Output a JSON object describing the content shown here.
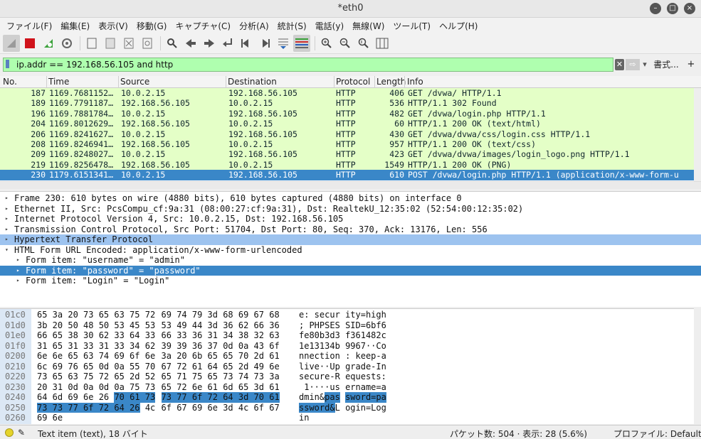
{
  "window": {
    "title": "*eth0"
  },
  "menu": [
    "ファイル(F)",
    "編集(E)",
    "表示(V)",
    "移動(G)",
    "キャプチャ(C)",
    "分析(A)",
    "統計(S)",
    "電話(y)",
    "無線(W)",
    "ツール(T)",
    "ヘルプ(H)"
  ],
  "filter": {
    "value": "ip.addr == 192.168.56.105 and http",
    "expr_label": "書式...",
    "plus": "+"
  },
  "columns": [
    "No.",
    "Time",
    "Source",
    "Destination",
    "Protocol",
    "Length",
    "Info"
  ],
  "packets": [
    {
      "no": "187",
      "time": "1169.7681152…",
      "src": "10.0.2.15",
      "dst": "192.168.56.105",
      "proto": "HTTP",
      "len": "406",
      "info": "GET /dvwa/ HTTP/1.1"
    },
    {
      "no": "189",
      "time": "1169.7791187…",
      "src": "192.168.56.105",
      "dst": "10.0.2.15",
      "proto": "HTTP",
      "len": "536",
      "info": "HTTP/1.1 302 Found"
    },
    {
      "no": "196",
      "time": "1169.7881784…",
      "src": "10.0.2.15",
      "dst": "192.168.56.105",
      "proto": "HTTP",
      "len": "482",
      "info": "GET /dvwa/login.php HTTP/1.1"
    },
    {
      "no": "204",
      "time": "1169.8012629…",
      "src": "192.168.56.105",
      "dst": "10.0.2.15",
      "proto": "HTTP",
      "len": "60",
      "info": "HTTP/1.1 200 OK  (text/html)"
    },
    {
      "no": "206",
      "time": "1169.8241627…",
      "src": "10.0.2.15",
      "dst": "192.168.56.105",
      "proto": "HTTP",
      "len": "430",
      "info": "GET /dvwa/dvwa/css/login.css HTTP/1.1"
    },
    {
      "no": "208",
      "time": "1169.8246941…",
      "src": "192.168.56.105",
      "dst": "10.0.2.15",
      "proto": "HTTP",
      "len": "957",
      "info": "HTTP/1.1 200 OK  (text/css)"
    },
    {
      "no": "209",
      "time": "1169.8248027…",
      "src": "10.0.2.15",
      "dst": "192.168.56.105",
      "proto": "HTTP",
      "len": "423",
      "info": "GET /dvwa/dvwa/images/login_logo.png HTTP/1.1"
    },
    {
      "no": "219",
      "time": "1169.8256478…",
      "src": "192.168.56.105",
      "dst": "10.0.2.15",
      "proto": "HTTP",
      "len": "1549",
      "info": "HTTP/1.1 200 OK  (PNG)"
    },
    {
      "no": "230",
      "time": "1179.6151341…",
      "src": "10.0.2.15",
      "dst": "192.168.56.105",
      "proto": "HTTP",
      "len": "610",
      "info": "POST /dvwa/login.php HTTP/1.1  (application/x-www-form-u"
    }
  ],
  "selected_packet_index": 8,
  "details": [
    {
      "text": "Frame 230: 610 bytes on wire (4880 bits), 610 bytes captured (4880 bits) on interface 0",
      "arrow": "▸",
      "indent": 0,
      "style": ""
    },
    {
      "text": "Ethernet II, Src: PcsCompu_cf:9a:31 (08:00:27:cf:9a:31), Dst: RealtekU_12:35:02 (52:54:00:12:35:02)",
      "arrow": "▸",
      "indent": 0,
      "style": ""
    },
    {
      "text": "Internet Protocol Version 4, Src: 10.0.2.15, Dst: 192.168.56.105",
      "arrow": "▸",
      "indent": 0,
      "style": ""
    },
    {
      "text": "Transmission Control Protocol, Src Port: 51704, Dst Port: 80, Seq: 370, Ack: 13176, Len: 556",
      "arrow": "▸",
      "indent": 0,
      "style": ""
    },
    {
      "text": "Hypertext Transfer Protocol",
      "arrow": "▸",
      "indent": 0,
      "style": "hl"
    },
    {
      "text": "HTML Form URL Encoded: application/x-www-form-urlencoded",
      "arrow": "▾",
      "indent": 0,
      "style": ""
    },
    {
      "text": "Form item: \"username\" = \"admin\"",
      "arrow": "▸",
      "indent": 1,
      "style": ""
    },
    {
      "text": "Form item: \"password\" = \"password\"",
      "arrow": "▸",
      "indent": 1,
      "style": "sel"
    },
    {
      "text": "Form item: \"Login\" = \"Login\"",
      "arrow": "▸",
      "indent": 1,
      "style": ""
    }
  ],
  "bytes": [
    {
      "off": "01c0",
      "hex1": "65 3a 20 73 65 63 75 72",
      "hex2": "69 74 79 3d 68 69 67 68",
      "asc1": "e: secur",
      "asc2": "ity=high"
    },
    {
      "off": "01d0",
      "hex1": "3b 20 50 48 50 53 45 53",
      "hex2": "53 49 44 3d 36 62 66 36",
      "asc1": "; PHPSES",
      "asc2": "SID=6bf6"
    },
    {
      "off": "01e0",
      "hex1": "66 65 38 30 62 33 64 33",
      "hex2": "66 33 36 31 34 38 32 63",
      "asc1": "fe80b3d3",
      "asc2": "f361482c"
    },
    {
      "off": "01f0",
      "hex1": "31 65 31 33 31 33 34 62",
      "hex2": "39 39 36 37 0d 0a 43 6f",
      "asc1": "1e13134b",
      "asc2": "9967··Co"
    },
    {
      "off": "0200",
      "hex1": "6e 6e 65 63 74 69 6f 6e",
      "hex2": "3a 20 6b 65 65 70 2d 61",
      "asc1": "nnection",
      "asc2": ": keep-a"
    },
    {
      "off": "0210",
      "hex1": "6c 69 76 65 0d 0a 55 70",
      "hex2": "67 72 61 64 65 2d 49 6e",
      "asc1": "live··Up",
      "asc2": "grade-In"
    },
    {
      "off": "0220",
      "hex1": "73 65 63 75 72 65 2d 52",
      "hex2": "65 71 75 65 73 74 73 3a",
      "asc1": "secure-R",
      "asc2": "equests:"
    },
    {
      "off": "0230",
      "hex1": "20 31 0d 0a 0d 0a 75 73",
      "hex2": "65 72 6e 61 6d 65 3d 61",
      "asc1": " 1····us",
      "asc2": "ername=a"
    },
    {
      "off": "0240",
      "hex1": "64 6d 69 6e 26 ",
      "hex1_hl": "70 61 73",
      "hex2": "",
      "hex2_hl": "73 77 6f 72 64 3d 70 61",
      "asc1": "dmin&",
      "asc1_hl": "pas",
      "asc2": "",
      "asc2_hl": "sword=pa"
    },
    {
      "off": "0250",
      "hex1": "",
      "hex1_hl": "73 73 77 6f 72 64 26",
      "hex1_tail": " 4c",
      "hex2": "6f 67 69 6e 3d 4c 6f 67",
      "asc1": "",
      "asc1_hl": "ssword&",
      "asc1_tail": "L",
      "asc2": "ogin=Log"
    },
    {
      "off": "0260",
      "hex1": "69 6e",
      "hex2": "",
      "asc1": "in",
      "asc2": ""
    }
  ],
  "status": {
    "left": "Text item (text), 18 バイト",
    "packets": "パケット数: 504 · 表示: 28 (5.6%)",
    "profile": "プロファイル: Default"
  },
  "colors": {
    "row_bg": "#e4ffc7",
    "selected": "#3a87c8",
    "filter_ok": "#afffaf",
    "highlight": "#9dc3ef"
  }
}
